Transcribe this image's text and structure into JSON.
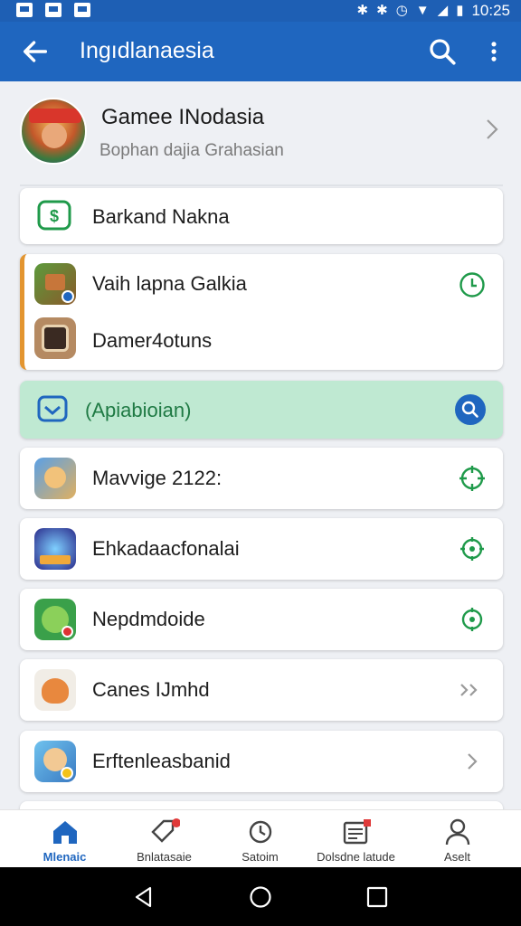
{
  "status_bar": {
    "time": "10:25"
  },
  "app_bar": {
    "title": "Ingıdlanaesia"
  },
  "profile": {
    "name": "Gamee INodasia",
    "subtitle": "Bophan dajia Grahasian"
  },
  "list": [
    {
      "label": "Barkand Nakna",
      "icon": "money-icon",
      "action": ""
    },
    {
      "label": "Vaih lapna Galkia",
      "icon": "game-icon",
      "action": "clock-icon"
    },
    {
      "label": "Damer4otuns",
      "icon": "game-icon",
      "action": ""
    },
    {
      "label": "(Apiabioian)",
      "icon": "inbox-icon",
      "action": "search-icon"
    },
    {
      "label": "Mavvige 2122:",
      "icon": "game-icon",
      "action": "target-icon"
    },
    {
      "label": "Ehkadaacfonalai",
      "icon": "game-icon",
      "action": "target-icon"
    },
    {
      "label": "Nepdmdoide",
      "icon": "game-icon",
      "action": "target-icon"
    },
    {
      "label": "Canes IJmhd",
      "icon": "game-icon",
      "action": "double-chevron-icon"
    },
    {
      "label": "Erftenleasbanid",
      "icon": "game-icon",
      "action": "chevron-right-icon"
    }
  ],
  "bottom_nav": [
    {
      "label": "Mlenaic",
      "icon": "home-icon",
      "active": true
    },
    {
      "label": "Bnlatasaie",
      "icon": "tag-icon",
      "active": false
    },
    {
      "label": "Satoim",
      "icon": "refresh-icon",
      "active": false
    },
    {
      "label": "Dolsdne latude",
      "icon": "calendar-icon",
      "active": false
    },
    {
      "label": "Aselt",
      "icon": "person-icon",
      "active": false
    }
  ],
  "colors": {
    "primary": "#1f66bf",
    "accent_green": "#1f9a4a",
    "highlight": "#bfe9d2",
    "orange": "#e39530"
  }
}
